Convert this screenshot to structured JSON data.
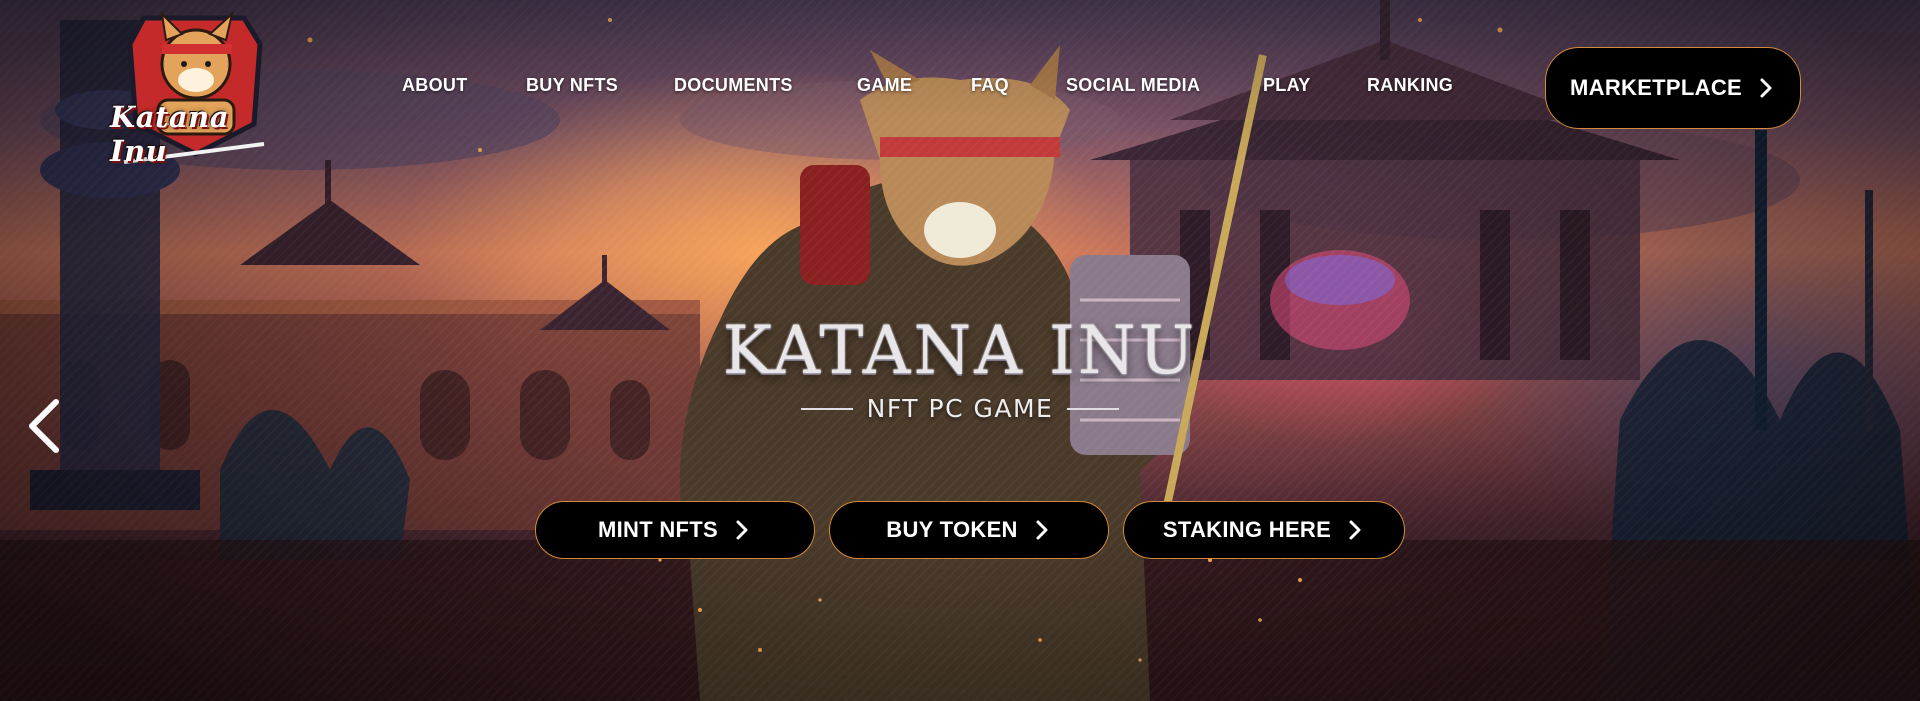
{
  "brand": {
    "logo_text": "Katana Inu"
  },
  "nav": {
    "items": [
      {
        "label": "ABOUT"
      },
      {
        "label": "BUY NFTS"
      },
      {
        "label": "DOCUMENTS"
      },
      {
        "label": "GAME"
      },
      {
        "label": "FAQ"
      },
      {
        "label": "SOCIAL MEDIA"
      },
      {
        "label": "PLAY"
      },
      {
        "label": "RANKING"
      }
    ],
    "marketplace_label": "MARKETPLACE"
  },
  "hero": {
    "title": "KATANA INU",
    "subtitle": "NFT PC GAME",
    "buttons": [
      {
        "label": "MINT NFTS"
      },
      {
        "label": "BUY TOKEN"
      },
      {
        "label": "STAKING HERE"
      }
    ]
  },
  "icons": {
    "chevron": "chevron-right-icon",
    "prev": "chevron-left-icon"
  },
  "colors": {
    "button_bg": "#000000",
    "button_border": "#d48a3a",
    "text": "#ffffff"
  }
}
